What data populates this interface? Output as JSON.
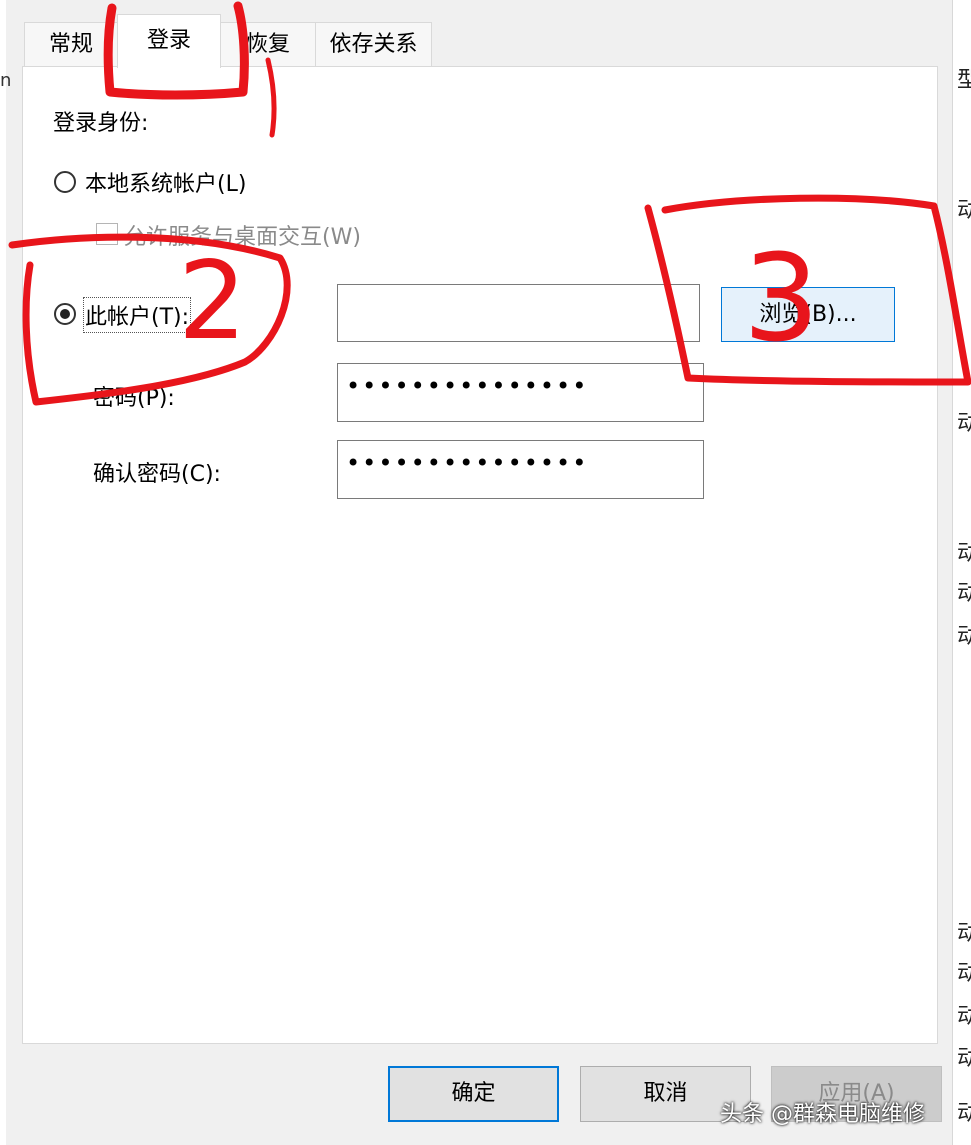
{
  "tabs": [
    {
      "label": "常规",
      "active": false
    },
    {
      "label": "登录",
      "active": true
    },
    {
      "label": "恢复",
      "active": false
    },
    {
      "label": "依存关系",
      "active": false
    }
  ],
  "logon": {
    "section_label": "登录身份:",
    "local_system": {
      "label": "本地系统帐户(L)",
      "selected": false
    },
    "allow_desktop": {
      "label": "允许服务与桌面交互(W)",
      "checked": false,
      "enabled": false
    },
    "this_account": {
      "label": "此帐户(T):",
      "selected": true,
      "value": ""
    },
    "browse_label": "浏览(B)...",
    "password": {
      "label": "密码(P):",
      "mask": "•••••••••••••••"
    },
    "confirm_password": {
      "label": "确认密码(C):",
      "mask": "•••••••••••••••"
    }
  },
  "footer": {
    "ok_label": "确定",
    "cancel_label": "取消",
    "apply_label": "应用(A)"
  },
  "annotations": {
    "mark_2": "2",
    "mark_3": "3",
    "color": "#e8151b"
  },
  "watermark": "头条 @群森电脑维修",
  "background_fragments": {
    "left": [
      "n"
    ],
    "right": [
      "型",
      "动",
      "动",
      "动",
      "动",
      "动",
      "动",
      "动",
      "动",
      "动",
      "动"
    ]
  },
  "colors": {
    "accent": "#0078d7",
    "panel_bg": "#ffffff",
    "dialog_bg": "#f0f0f0"
  }
}
